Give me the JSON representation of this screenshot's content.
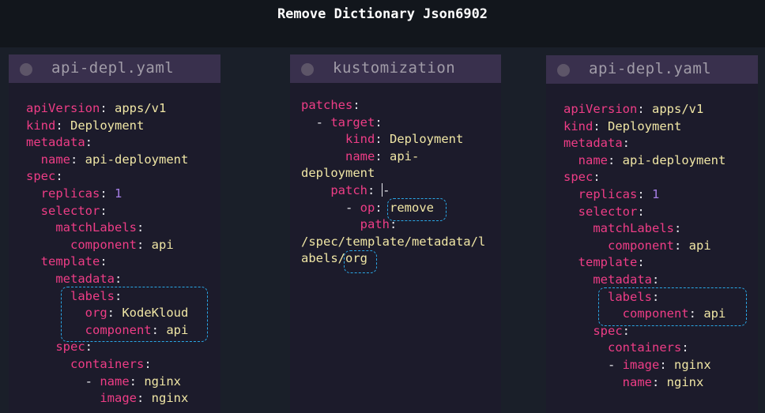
{
  "title": "Remove Dictionary Json6902",
  "panels": {
    "left": {
      "title": "api-depl.yaml",
      "lines": [
        {
          "key": "apiVersion",
          "val": "apps/v1"
        },
        {
          "key": "kind",
          "val": "Deployment"
        },
        {
          "key": "metadata",
          "val": ""
        },
        {
          "key": "  name",
          "val": "api-deployment"
        },
        {
          "key": "spec",
          "val": ""
        },
        {
          "key": "  replicas",
          "val": "1"
        },
        {
          "key": "  selector",
          "val": ""
        },
        {
          "key": "    matchLabels",
          "val": ""
        },
        {
          "key": "      component",
          "val": "api"
        },
        {
          "key": "  template",
          "val": ""
        },
        {
          "key": "    metadata",
          "val": ""
        },
        {
          "key": "      labels",
          "val": ""
        },
        {
          "key": "        org",
          "val": "KodeKloud"
        },
        {
          "key": "        component",
          "val": "api"
        },
        {
          "key": "    spec",
          "val": ""
        },
        {
          "key": "      containers",
          "val": ""
        },
        {
          "key": "        - name",
          "val": "nginx"
        },
        {
          "key": "          image",
          "val": "nginx"
        }
      ]
    },
    "middle": {
      "title": "kustomization",
      "l1_key": "patches",
      "l2_dash": "  - ",
      "l2_key": "target",
      "l3_key": "kind",
      "l3_val": "Deployment",
      "l4_key": "name",
      "l4_val": "api-",
      "l5_val": "deployment",
      "l6_key": "patch",
      "l6_val": "-",
      "l7_dash": "- ",
      "l7_key": "op",
      "l7_val": "remove",
      "l8_key": "path",
      "l9_val": "/spec/template/metadata/l",
      "l10_val_a": "abels/",
      "l10_val_b": "org"
    },
    "right": {
      "title": "api-depl.yaml",
      "lines": [
        {
          "key": "apiVersion",
          "val": "apps/v1"
        },
        {
          "key": "kind",
          "val": "Deployment"
        },
        {
          "key": "metadata",
          "val": ""
        },
        {
          "key": "  name",
          "val": "api-deployment"
        },
        {
          "key": "spec",
          "val": ""
        },
        {
          "key": "  replicas",
          "val": "1"
        },
        {
          "key": "  selector",
          "val": ""
        },
        {
          "key": "    matchLabels",
          "val": ""
        },
        {
          "key": "      component",
          "val": "api"
        },
        {
          "key": "  template",
          "val": ""
        },
        {
          "key": "    metadata",
          "val": ""
        },
        {
          "key": "      labels",
          "val": ""
        },
        {
          "key": "        component",
          "val": "api"
        },
        {
          "key": "    spec",
          "val": ""
        },
        {
          "key": "      containers",
          "val": ""
        },
        {
          "key": "      - image",
          "val": "nginx"
        },
        {
          "key": "        name",
          "val": "nginx"
        }
      ]
    }
  }
}
